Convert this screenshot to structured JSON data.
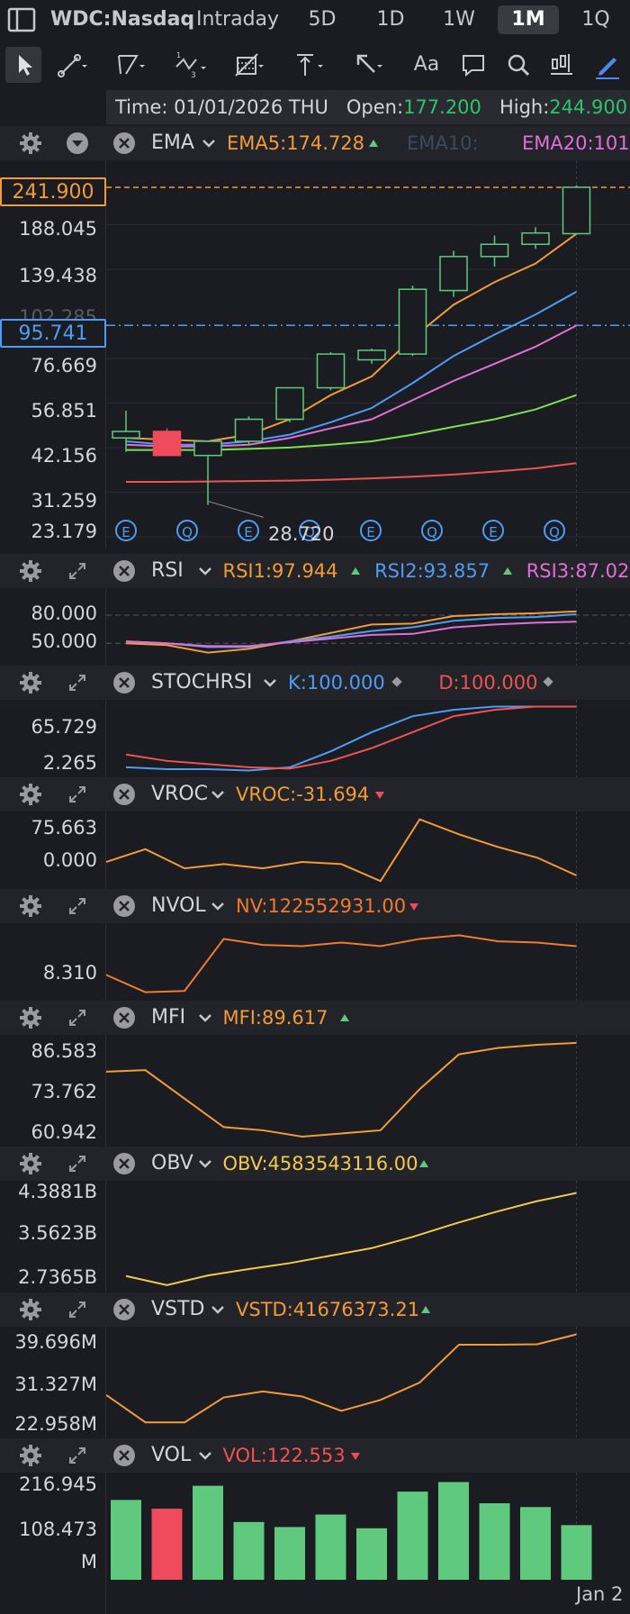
{
  "tabs": {
    "symbol": "WDC:Nasdaq",
    "items": [
      "Intraday",
      "5D",
      "1D",
      "1W",
      "1M",
      "1Q"
    ],
    "active": "1M"
  },
  "toolbar": {
    "icons": [
      "cursor-icon",
      "line-tool-icon",
      "channel-tool-icon",
      "wave-tool-icon",
      "fib-tool-icon",
      "measure-tool-icon",
      "arrow-tool-icon",
      "text-tool-icon",
      "comment-icon",
      "search-icon",
      "indicator-icon",
      "pen-icon"
    ],
    "text_tool_label": "Aa"
  },
  "info": {
    "time_label": "Time:",
    "time": "01/01/2026 THU",
    "open_label": "Open:",
    "open": "177.200",
    "high_label": "High:",
    "high": "244.900"
  },
  "main": {
    "indicator": "EMA",
    "ema5": "EMA5:174.728",
    "ema10": "EMA10:",
    "ema20": "EMA20:101",
    "axis": [
      "188.045",
      "139.438",
      "76.669",
      "56.851",
      "42.156",
      "31.259",
      "23.179"
    ],
    "tag_top": "241.900",
    "tag_mid": "95.741",
    "hidden_label": "102.285",
    "low_label": "28.720",
    "events": [
      "E",
      "Q",
      "E",
      "Q",
      "E",
      "Q",
      "E",
      "Q"
    ],
    "colors": {
      "ema5": "#f29b38",
      "ema10": "#4d9cf5",
      "ema20": "#e06fd8",
      "ema_green": "#7be14f",
      "ema_red": "#ef5350",
      "up": "#5fc97e",
      "down": "#ef4b5d"
    }
  },
  "panes": {
    "rsi": {
      "name": "RSI",
      "v1": "RSI1:97.944",
      "v2": "RSI2:93.857",
      "v3": "RSI3:87.02",
      "axis": [
        "80.000",
        "50.000"
      ]
    },
    "stoch": {
      "name": "STOCHRSI",
      "k": "K:100.000",
      "d": "D:100.000",
      "axis": [
        "65.729",
        "2.265"
      ]
    },
    "vroc": {
      "name": "VROC",
      "v": "VROC:-31.694",
      "axis": [
        "75.663",
        "0.000"
      ]
    },
    "nvol": {
      "name": "NVOL",
      "v": "NV:122552931.00",
      "axis": [
        "8.310"
      ]
    },
    "mfi": {
      "name": "MFI",
      "v": "MFI:89.617",
      "axis": [
        "86.583",
        "73.762",
        "60.942"
      ]
    },
    "obv": {
      "name": "OBV",
      "v": "OBV:4583543116.00",
      "axis": [
        "4.3881B",
        "3.5623B",
        "2.7365B"
      ]
    },
    "vstd": {
      "name": "VSTD",
      "v": "VSTD:41676373.21",
      "axis": [
        "39.696M",
        "31.327M",
        "22.958M"
      ]
    },
    "vol": {
      "name": "VOL",
      "v": "VOL:122.553",
      "axis": [
        "216.945",
        "108.473",
        "M"
      ]
    }
  },
  "bottom": {
    "date": "Jan 2"
  },
  "chart_data": [
    {
      "type": "candlestick",
      "title": "WDC:Nasdaq 1M",
      "y_ticks": [
        23.179,
        31.259,
        42.156,
        56.851,
        76.669,
        139.438,
        188.045
      ],
      "candles": [
        {
          "o": 45,
          "h": 54,
          "l": 41,
          "c": 47,
          "dir": "up"
        },
        {
          "o": 47,
          "h": 48,
          "l": 40,
          "c": 40,
          "dir": "down"
        },
        {
          "o": 40,
          "h": 44,
          "l": 28.72,
          "c": 44,
          "dir": "up"
        },
        {
          "o": 44,
          "h": 52,
          "l": 43,
          "c": 51,
          "dir": "up"
        },
        {
          "o": 51,
          "h": 63,
          "l": 50,
          "c": 63,
          "dir": "up"
        },
        {
          "o": 63,
          "h": 80,
          "l": 62,
          "c": 79,
          "dir": "up"
        },
        {
          "o": 76,
          "h": 82,
          "l": 74,
          "c": 81,
          "dir": "up"
        },
        {
          "o": 79,
          "h": 125,
          "l": 78,
          "c": 122,
          "dir": "up"
        },
        {
          "o": 121,
          "h": 158,
          "l": 116,
          "c": 152,
          "dir": "up"
        },
        {
          "o": 152,
          "h": 175,
          "l": 142,
          "c": 165,
          "dir": "up"
        },
        {
          "o": 165,
          "h": 185,
          "l": 160,
          "c": 178,
          "dir": "up"
        },
        {
          "o": 177.2,
          "h": 244.9,
          "l": 176,
          "c": 241.9,
          "dir": "up"
        }
      ],
      "series": [
        {
          "name": "EMA5",
          "values": [
            45,
            44.5,
            44,
            46,
            51,
            60,
            68,
            88,
            110,
            128,
            145,
            177
          ]
        },
        {
          "name": "EMA10",
          "values": [
            44,
            43,
            43,
            44,
            46,
            50,
            55,
            65,
            78,
            90,
            103,
            120
          ]
        },
        {
          "name": "EMA20",
          "values": [
            43,
            42.5,
            42.5,
            43,
            45,
            48,
            51,
            58,
            66,
            74,
            83,
            95.7
          ]
        },
        {
          "name": "EMA_green",
          "values": [
            41.5,
            41.5,
            41.5,
            41.8,
            42.2,
            43,
            44,
            46,
            48.5,
            51,
            54.5,
            60
          ]
        },
        {
          "name": "EMA_red",
          "values": [
            33.5,
            33.5,
            33.6,
            33.7,
            33.8,
            34,
            34.3,
            34.7,
            35.2,
            35.9,
            36.7,
            38
          ]
        }
      ]
    },
    {
      "type": "line",
      "title": "RSI",
      "ylim": [
        30,
        105
      ],
      "series": [
        {
          "name": "RSI1",
          "values": [
            50,
            48,
            40,
            44,
            52,
            61,
            70,
            71,
            79,
            81,
            82,
            84
          ]
        },
        {
          "name": "RSI2",
          "values": [
            52,
            50,
            46,
            46,
            52,
            57,
            63,
            67,
            74,
            77,
            78,
            81
          ]
        },
        {
          "name": "RSI3",
          "values": [
            52,
            50,
            47,
            47,
            51,
            55,
            59,
            60,
            67,
            70,
            72,
            73
          ]
        }
      ]
    },
    {
      "type": "line",
      "title": "STOCHRSI",
      "ylim": [
        -5,
        105
      ],
      "series": [
        {
          "name": "K",
          "values": [
            5,
            2,
            2,
            0,
            5,
            30,
            60,
            85,
            95,
            100,
            100,
            100
          ]
        },
        {
          "name": "D",
          "values": [
            25,
            15,
            10,
            5,
            3,
            15,
            35,
            60,
            85,
            95,
            100,
            100
          ]
        }
      ]
    },
    {
      "type": "line",
      "title": "VROC",
      "series": [
        {
          "name": "VROC",
          "values": [
            0,
            30,
            -15,
            -5,
            -15,
            0,
            -5,
            -45,
            100,
            65,
            35,
            10,
            -31.694
          ]
        }
      ]
    },
    {
      "type": "line",
      "title": "NVOL",
      "series": [
        {
          "name": "NV",
          "values": [
            8.31,
            -6,
            -5,
            38,
            33,
            32,
            35,
            32,
            38,
            41,
            36,
            35,
            32
          ]
        }
      ]
    },
    {
      "type": "line",
      "title": "MFI",
      "series": [
        {
          "name": "MFI",
          "values": [
            80.5,
            81,
            72,
            63,
            62,
            60,
            61,
            62,
            75,
            86,
            88,
            89,
            89.617
          ]
        }
      ]
    },
    {
      "type": "line",
      "title": "OBV",
      "series": [
        {
          "name": "OBV",
          "values": [
            2.79,
            2.62,
            2.8,
            2.92,
            3.03,
            3.17,
            3.31,
            3.52,
            3.76,
            3.98,
            4.18,
            4.34
          ]
        }
      ]
    },
    {
      "type": "line",
      "title": "VSTD",
      "series": [
        {
          "name": "VSTD",
          "values": [
            29.5,
            24.0,
            24.0,
            29.0,
            30.2,
            29.2,
            26.3,
            28.5,
            32.0,
            39.6,
            39.6,
            39.7,
            41.68
          ]
        }
      ]
    },
    {
      "type": "bar",
      "title": "VOL",
      "series": [
        {
          "name": "VOL",
          "values": [
            183,
            162,
            217,
            130,
            118,
            148,
            115,
            203,
            226,
            175,
            166,
            122.553
          ]
        }
      ],
      "colors": [
        "up",
        "down",
        "up",
        "up",
        "up",
        "up",
        "up",
        "up",
        "up",
        "up",
        "up",
        "up"
      ]
    }
  ]
}
